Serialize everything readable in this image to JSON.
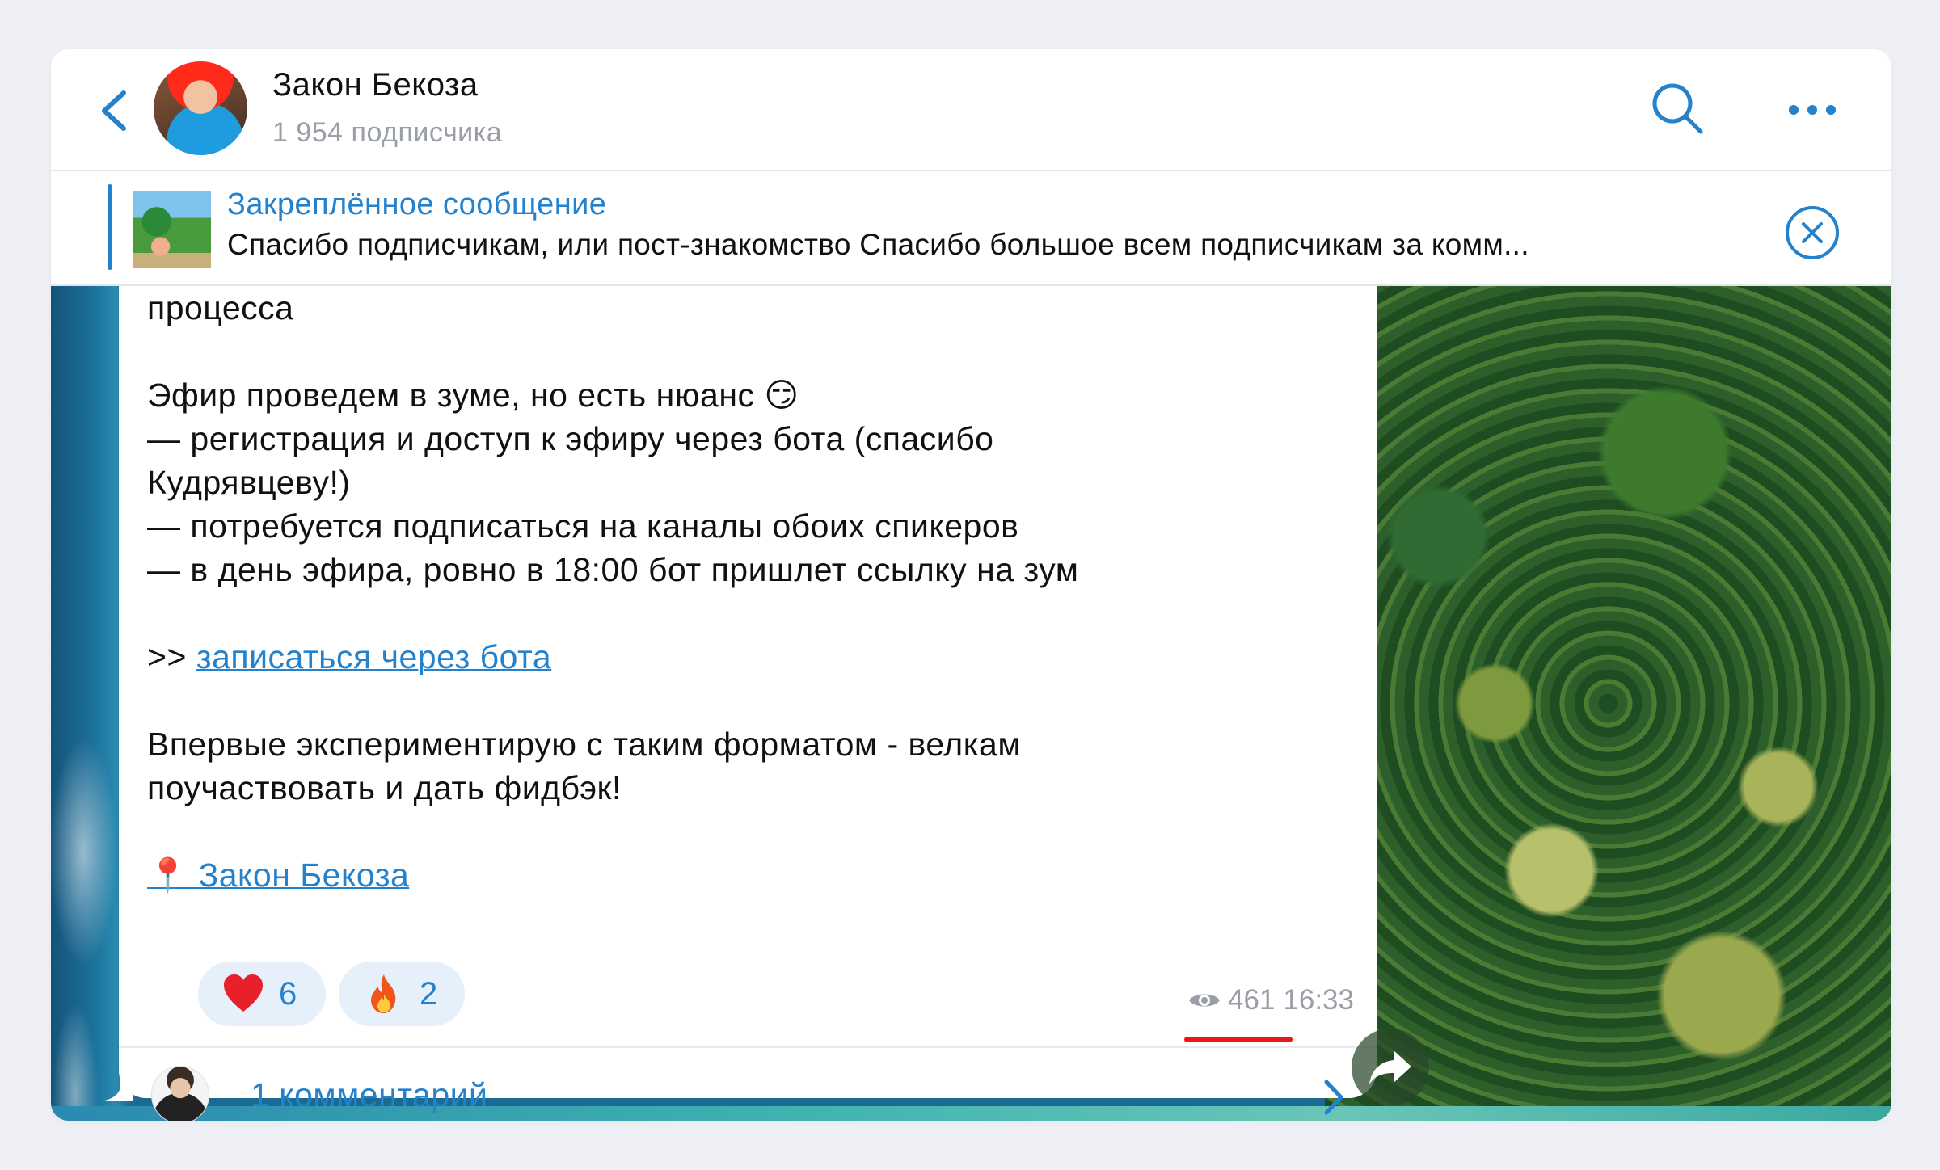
{
  "header": {
    "channel_name": "Закон Бекоза",
    "subscribers": "1 954 подписчика"
  },
  "pinned": {
    "title": "Закреплённое сообщение",
    "text": "Спасибо подписчикам, или пост-знакомство  Спасибо большое всем подписчикам за комм..."
  },
  "message": {
    "line1": "процесса",
    "line2": "Эфир проведем в зуме, но есть нюанс 😏",
    "line3": "— регистрация и доступ к эфиру через бота (спасибо Кудрявцеву!)",
    "line4": "— потребуется подписаться на каналы обоих спикеров",
    "line5": "— в день эфира, ровно в 18:00 бот пришлет ссылку на зум",
    "link_prefix": ">> ",
    "link_text": "записаться через бота",
    "line6": "Впервые экспериментирую с таким форматом - велкам поучаствовать и дать фидбэк!",
    "signature": "📍 Закон Бекоза"
  },
  "reactions": [
    {
      "emoji": "heart",
      "count": "6"
    },
    {
      "emoji": "fire",
      "count": "2"
    }
  ],
  "meta": {
    "views": "461",
    "time": "16:33"
  },
  "comments": {
    "label": "1 комментарий"
  },
  "colors": {
    "accent": "#2481cc",
    "highlight_underline": "#e8181a"
  }
}
